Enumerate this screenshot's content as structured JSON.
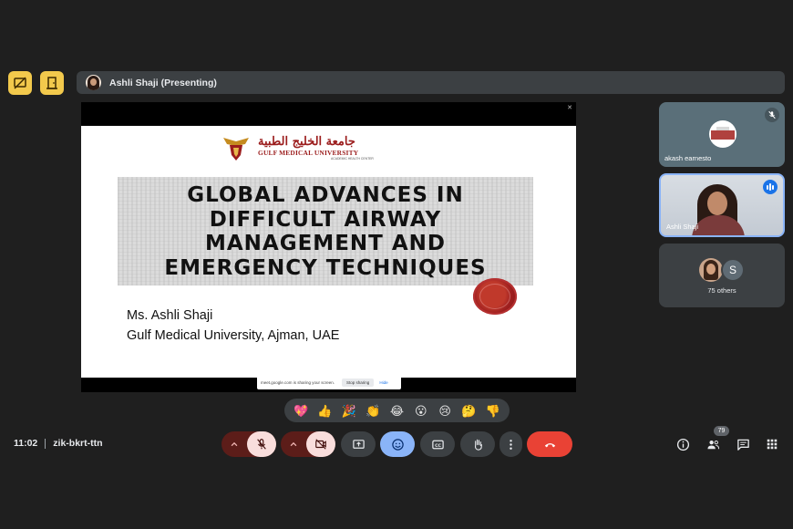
{
  "presenter_bar": {
    "label": "Ashli Shaji (Presenting)"
  },
  "slide": {
    "arabic_name": "جامعة الخليج الطبية",
    "university_name": "GULF MEDICAL UNIVERSITY",
    "tagline": "ACADEMIC HEALTH CENTER",
    "title_lines": [
      "GLOBAL ADVANCES IN",
      "DIFFICULT AIRWAY",
      "MANAGEMENT AND",
      "EMERGENCY TECHNIQUES"
    ],
    "speaker": "Ms. Ashli Shaji",
    "affiliation": "Gulf Medical University, Ajman, UAE"
  },
  "share_notice": {
    "text": "meet.google.com is sharing your screen.",
    "stop_label": "Stop sharing",
    "hide_label": "Hide"
  },
  "participants": {
    "tile1_name": "akash earnesto",
    "tile2_name": "Ashli Shaji",
    "others_initial": "S",
    "others_label": "75 others"
  },
  "reactions": [
    "💖",
    "👍",
    "🎉",
    "👏",
    "😂",
    "😮",
    "😢",
    "🤔",
    "👎"
  ],
  "meeting": {
    "time": "11:02",
    "code": "zik-bkrt-ttn"
  },
  "people_count": "79",
  "colors": {
    "background": "#1f1f1f",
    "accent_yellow": "#f2c94c",
    "end_call_red": "#e94235",
    "active_blue": "#8ab4f8",
    "brand_maroon": "#9b1c1c"
  }
}
